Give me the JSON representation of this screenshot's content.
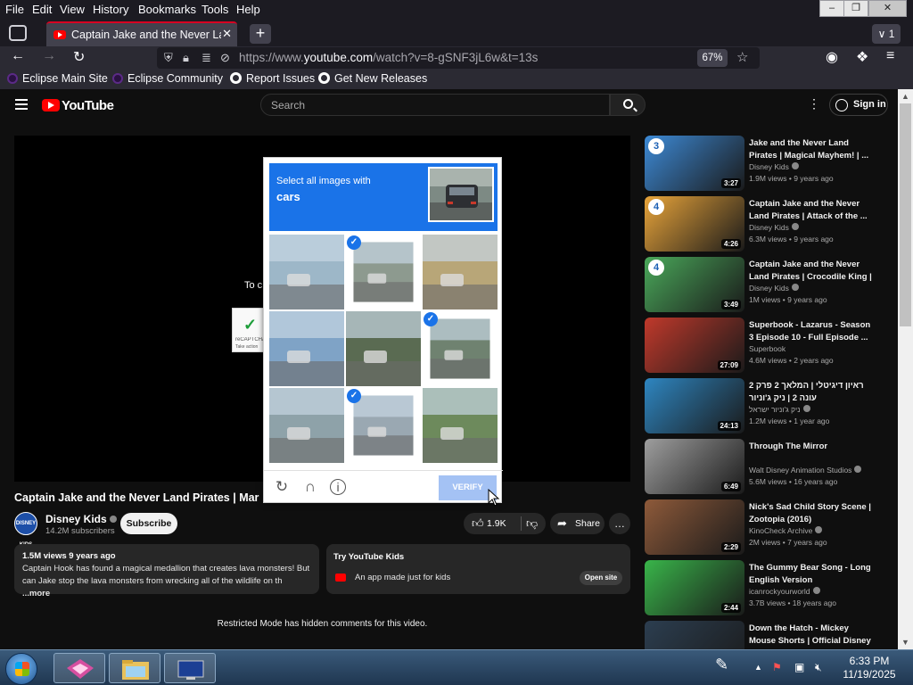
{
  "browser": {
    "menu": [
      "File",
      "Edit",
      "View",
      "History",
      "Bookmarks",
      "Tools",
      "Help"
    ],
    "tab_title": "Captain Jake and the Never Land Pirates | Magical Mayhem!",
    "tab_count": "1",
    "url_prefix": "https://www.",
    "url_domain": "youtube.com",
    "url_path": "/watch?v=8-gSNF3jL6w&t=13s",
    "zoom": "67%",
    "bookmarks": [
      "Eclipse Main Site",
      "Eclipse Community",
      "Report Issues",
      "Get New Releases"
    ]
  },
  "youtube": {
    "logo": "YouTube",
    "search_placeholder": "Search",
    "signin": "Sign in",
    "player_text": "To c",
    "recaptcha_label": "reCAPTCHA",
    "recaptcha_sub": "Take action",
    "video_title": "Captain Jake and the Never Land Pirates | Mar",
    "channel": "Disney Kids",
    "channel_badge": "DISNEY KIDS",
    "subscribers": "14.2M subscribers",
    "subscribe": "Subscribe",
    "likes": "1.9K",
    "share": "Share",
    "desc_meta": "1.5M views  9 years ago",
    "desc_line1": "Captain Hook has found a magical medallion that creates lava monsters! But",
    "desc_line2": "can Jake stop the lava monsters from wrecking all of the wildlife on th",
    "desc_more": "...more",
    "kids_title": "Try YouTube Kids",
    "kids_sub": "An app made just for kids",
    "kids_btn": "Open site",
    "restricted": "Restricted Mode has hidden comments for this video."
  },
  "sidebar": [
    {
      "title": "Jake and the Never Land Pirates | Magical Mayhem! | ...",
      "channel": "Disney Kids",
      "verified": true,
      "meta": "1.9M views • 9 years ago",
      "duration": "3:27",
      "color": "#3d8ad6",
      "num": "3"
    },
    {
      "title": "Captain Jake and the Never Land Pirates | Attack of the ...",
      "channel": "Disney Kids",
      "verified": true,
      "meta": "6.3M views • 9 years ago",
      "duration": "4:26",
      "color": "#e8a43a",
      "num": "4"
    },
    {
      "title": "Captain Jake and the Never Land Pirates | Crocodile King | ...",
      "channel": "Disney Kids",
      "verified": true,
      "meta": "1M views • 9 years ago",
      "duration": "3:49",
      "color": "#4aa85a",
      "num": "4"
    },
    {
      "title": "Superbook - Lazarus - Season 3 Episode 10 - Full Episode ...",
      "channel": "Superbook",
      "verified": false,
      "meta": "4.6M views • 2 years ago",
      "duration": "27:09",
      "color": "#c0392b",
      "num": ""
    },
    {
      "title": "ראיון דיגיטלי | המלאך 2 פרק 2 עונה 2 | ניק ג'וניור",
      "channel": "ניק ג'וניור ישראל",
      "verified": true,
      "meta": "1.2M views • 1 year ago",
      "duration": "24:13",
      "color": "#2e86c1",
      "num": ""
    },
    {
      "title": "Through The Mirror",
      "channel": "Walt Disney Animation Studios",
      "verified": true,
      "meta": "5.6M views • 16 years ago",
      "duration": "6:49",
      "color": "#9e9e9e",
      "num": ""
    },
    {
      "title": "Nick's Sad Child Story Scene | Zootopia (2016)",
      "channel": "KinoCheck Archive",
      "verified": true,
      "meta": "2M views • 7 years ago",
      "duration": "2:29",
      "color": "#8e5a3a",
      "num": ""
    },
    {
      "title": "The Gummy Bear Song - Long English Version",
      "channel": "icanrockyourworld",
      "verified": true,
      "meta": "3.7B views • 18 years ago",
      "duration": "2:44",
      "color": "#39b54a",
      "num": ""
    },
    {
      "title": "Down the Hatch - Mickey Mouse Shorts | Official Disney UK HD",
      "channel": "",
      "verified": false,
      "meta": "",
      "duration": "",
      "color": "#2c3e50",
      "num": ""
    }
  ],
  "captcha": {
    "instruction": "Select all images with",
    "target": "cars",
    "verify": "VERIFY",
    "tiles": [
      {
        "selected": false,
        "color": "#9db7c8"
      },
      {
        "selected": true,
        "color": "#8d9a8f"
      },
      {
        "selected": false,
        "color": "#b8a678"
      },
      {
        "selected": false,
        "color": "#7fa3c6"
      },
      {
        "selected": false,
        "color": "#5a6b52"
      },
      {
        "selected": true,
        "color": "#6f8270"
      },
      {
        "selected": false,
        "color": "#8ea2a9"
      },
      {
        "selected": true,
        "color": "#9aa8b2"
      },
      {
        "selected": false,
        "color": "#6d8a5c"
      }
    ]
  },
  "taskbar": {
    "time": "6:33 PM",
    "date": "11/19/2025"
  }
}
